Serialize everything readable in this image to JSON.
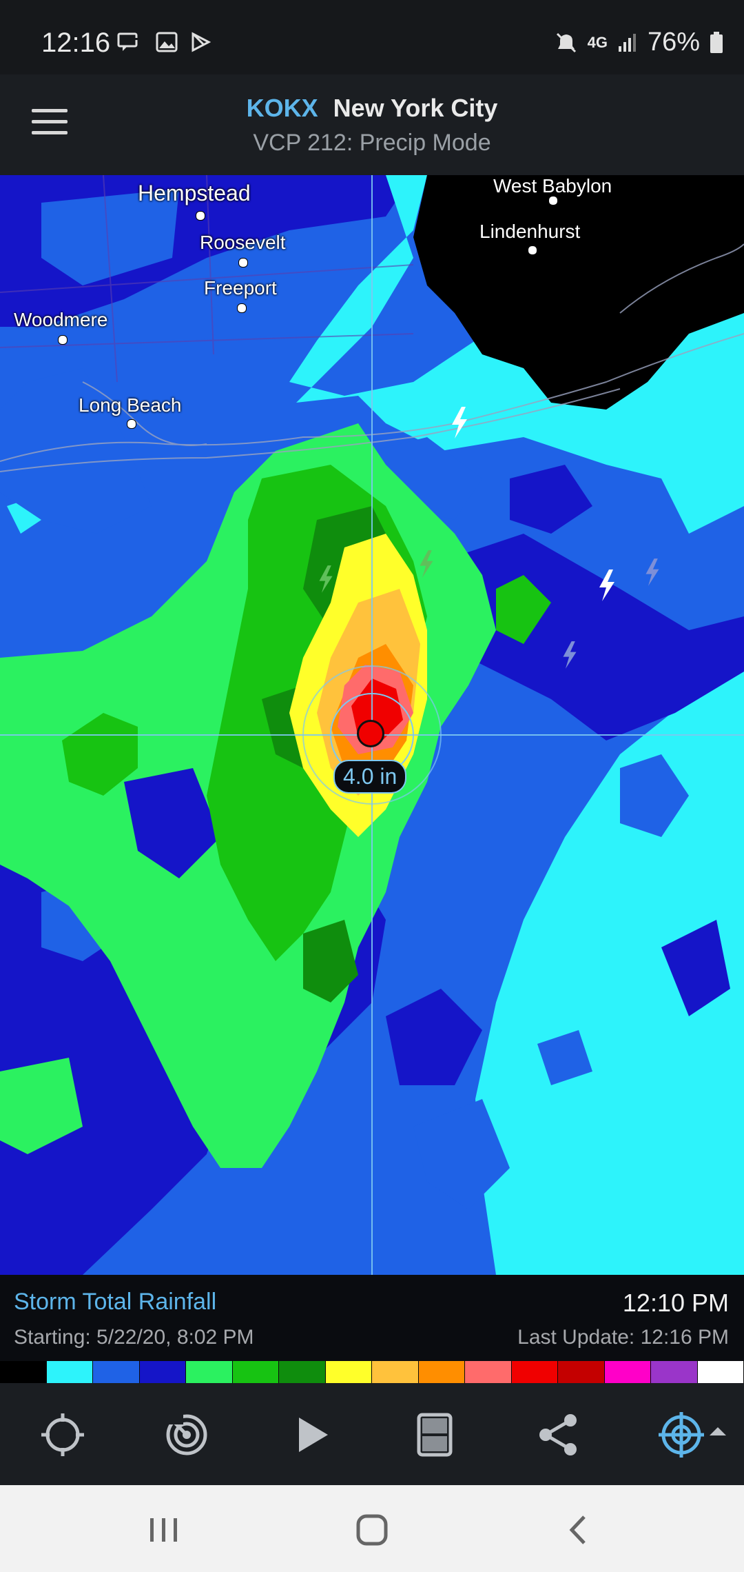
{
  "status_bar": {
    "time": "12:16",
    "battery": "76%",
    "network": "4G"
  },
  "header": {
    "station": "KOKX",
    "city": "New York City",
    "mode": "VCP 212: Precip Mode",
    "menu_icon": "hamburger-menu-icon"
  },
  "map": {
    "places": [
      {
        "name": "Hempstead"
      },
      {
        "name": "Roosevelt"
      },
      {
        "name": "Freeport"
      },
      {
        "name": "Woodmere"
      },
      {
        "name": "Long Beach"
      },
      {
        "name": "West Babylon"
      },
      {
        "name": "Lindenhurst"
      }
    ],
    "probe_value": "4.0 in",
    "lightning_icon": "lightning-icon"
  },
  "info_panel": {
    "product": "Storm Total Rainfall",
    "starting": "Starting: 5/22/20, 8:02 PM",
    "time": "12:10 PM",
    "last_update": "Last Update: 12:16 PM"
  },
  "legend": {
    "colors": [
      "#000000",
      "#2df3fb",
      "#1f62e6",
      "#1515c8",
      "#2bf160",
      "#17c312",
      "#0f8d0d",
      "#ffff2a",
      "#ffc23c",
      "#ff8e00",
      "#ff6b6b",
      "#f00000",
      "#c40000",
      "#ff00c8",
      "#9a35c9",
      "#ffffff"
    ]
  },
  "toolbar": {
    "buttons": [
      "locate-icon",
      "radar-icon",
      "play-icon",
      "layout-icon",
      "share-icon",
      "crosshair-icon"
    ]
  },
  "nav_bar": {
    "buttons": [
      "recents-icon",
      "home-icon",
      "back-icon"
    ]
  }
}
